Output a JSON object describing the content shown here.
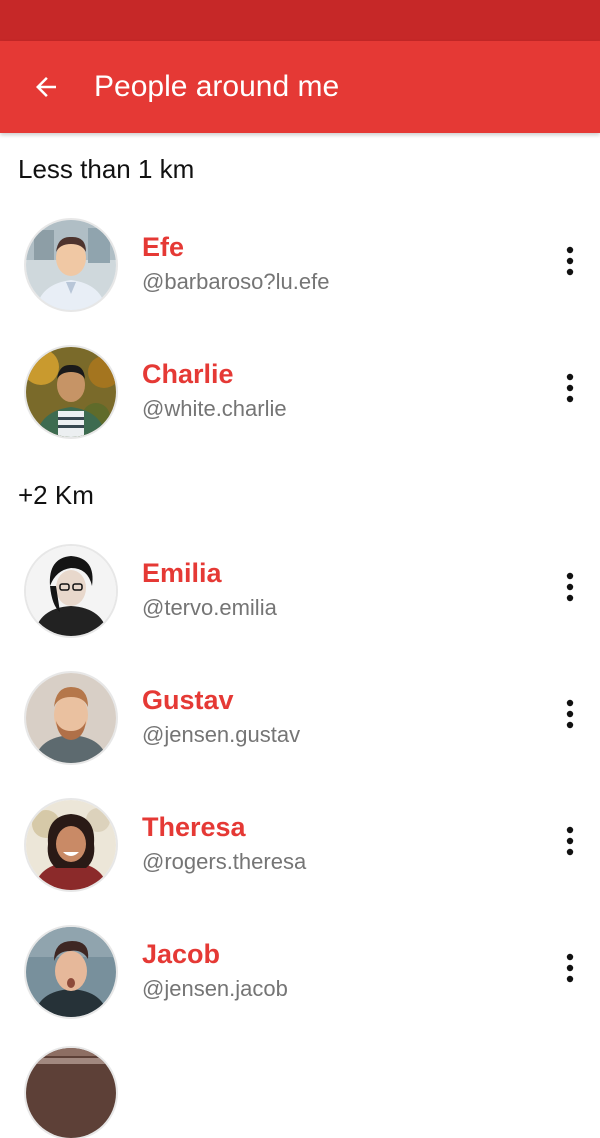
{
  "app_bar": {
    "title": "People around me",
    "back_icon": "arrow-back-icon"
  },
  "sections": [
    {
      "header": "Less than 1 km",
      "people": [
        {
          "name": "Efe",
          "handle": "@barbaroso?lu.efe"
        },
        {
          "name": "Charlie",
          "handle": "@white.charlie"
        }
      ]
    },
    {
      "header": "+2 Km",
      "people": [
        {
          "name": "Emilia",
          "handle": "@tervo.emilia"
        },
        {
          "name": "Gustav",
          "handle": "@jensen.gustav"
        },
        {
          "name": "Theresa",
          "handle": "@rogers.theresa"
        },
        {
          "name": "Jacob",
          "handle": "@jensen.jacob"
        }
      ]
    }
  ],
  "colors": {
    "primary": "#e53935",
    "primary_dark": "#c62828",
    "handle_text": "#757575"
  },
  "row_menu_icon": "more-vertical-icon"
}
